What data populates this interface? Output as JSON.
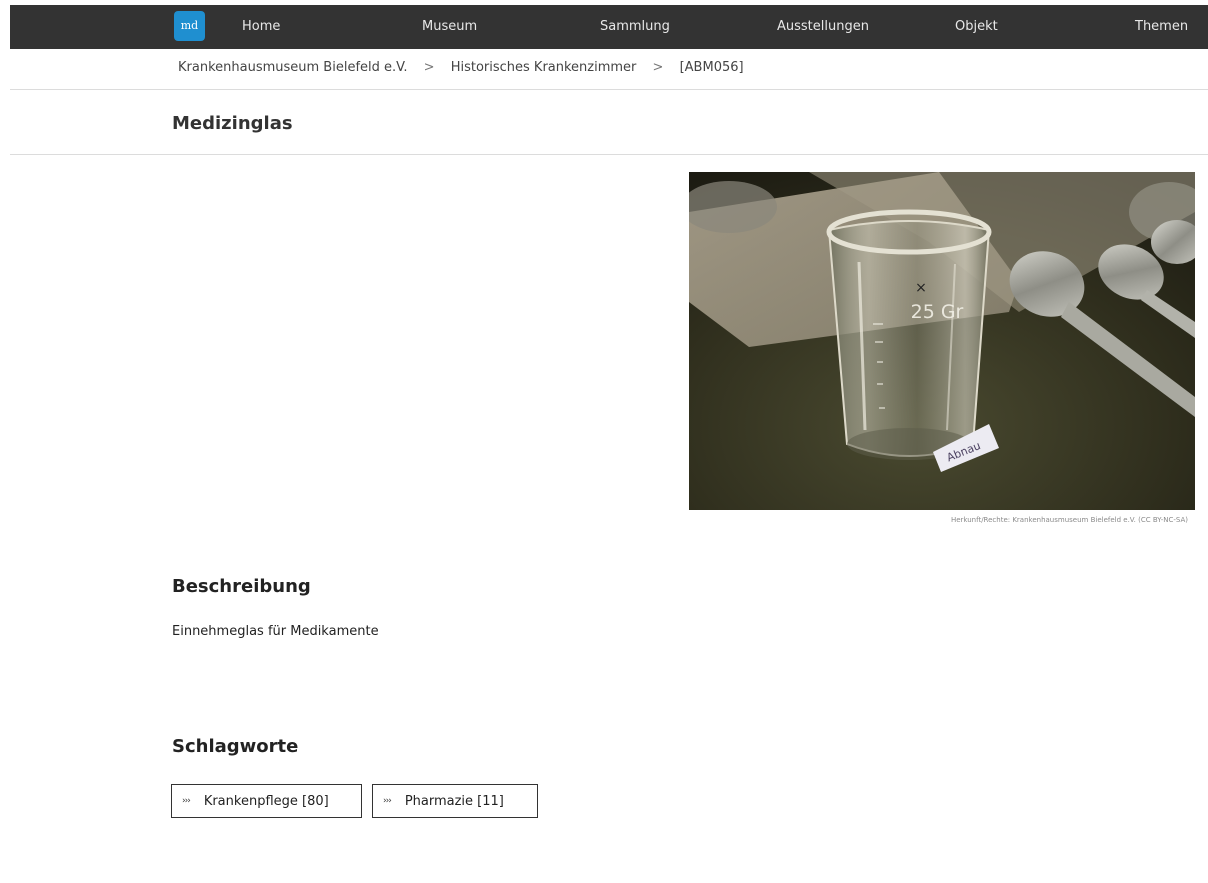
{
  "nav": {
    "logo": "md",
    "items": [
      "Home",
      "Museum",
      "Sammlung",
      "Ausstellungen",
      "Objekt",
      "Themen"
    ]
  },
  "breadcrumb": [
    "Krankenhausmuseum Bielefeld e.V.",
    "Historisches Krankenzimmer",
    "[ABM056]"
  ],
  "breadcrumb_separator": ">",
  "title": "Medizinglas",
  "image": {
    "caption": "Herkunft/Rechte: Krankenhausmuseum Bielefeld e.V. (CC BY-NC-SA)",
    "glass_marking": "25 Gr",
    "label_text": "Abnau"
  },
  "description": {
    "heading": "Beschreibung",
    "text": "Einnehmeglas für Medikamente"
  },
  "keywords": {
    "heading": "Schlagworte",
    "tags": [
      "Krankenpflege [80]",
      "Pharmazie [11]"
    ]
  }
}
